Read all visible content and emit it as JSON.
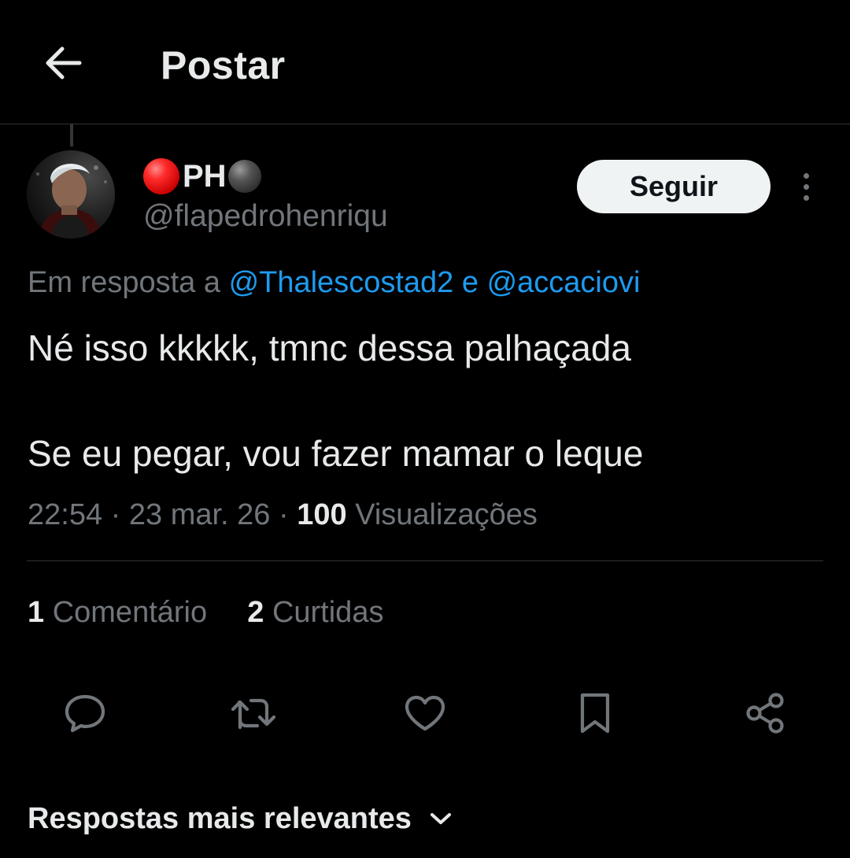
{
  "header": {
    "title": "Postar",
    "back_icon": "arrow-left-icon"
  },
  "tweet": {
    "author": {
      "display_name": "PH",
      "display_name_emoji_before": "red-ball-emoji",
      "display_name_emoji_after": "black-ball-emoji",
      "handle": "@flapedrohenriqu"
    },
    "follow_label": "Seguir",
    "reply_to": {
      "prefix": "Em resposta a",
      "user1": "@Thalescostad2",
      "conjunction": "e",
      "user2": "@accaciovi"
    },
    "text_line1": "Né isso kkkkk, tmnc dessa palhaçada",
    "text_line2": "Se eu pegar, vou fazer mamar o leque",
    "meta": {
      "time": "22:54",
      "separator": "·",
      "date": "23 mar. 26",
      "views_count": "100",
      "views_label": "Visualizações"
    },
    "stats": {
      "comments_count": "1",
      "comments_label": "Comentário",
      "likes_count": "2",
      "likes_label": "Curtidas"
    }
  },
  "actions": [
    "reply-icon",
    "retweet-icon",
    "like-icon",
    "bookmark-icon",
    "share-icon"
  ],
  "replies_sort": {
    "label": "Respostas mais relevantes",
    "icon": "chevron-down-icon"
  },
  "colors": {
    "background": "#000000",
    "text_primary": "#e7e9ea",
    "text_secondary": "#71767b",
    "link": "#1d9bf0",
    "divider": "#2f3336",
    "follow_bg": "#eff3f4"
  }
}
